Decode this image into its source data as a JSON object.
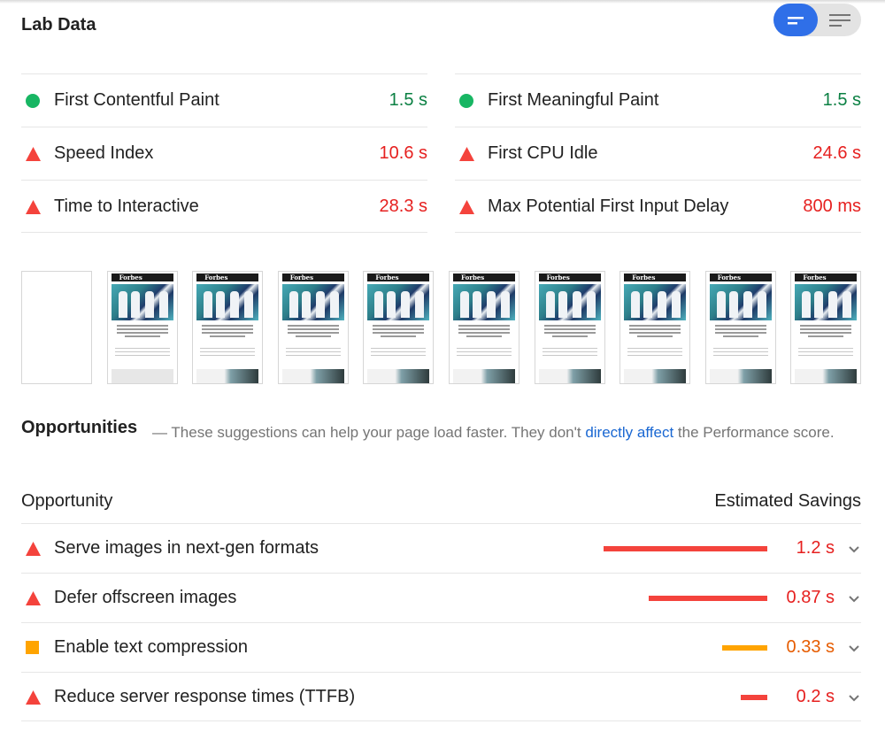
{
  "section_title": "Lab Data",
  "view_toggle": {
    "options": [
      {
        "icon": "opportunity-view-icon",
        "active": true
      },
      {
        "icon": "list-view-icon",
        "active": false
      }
    ],
    "active_color": "#2f6fe8"
  },
  "metrics": {
    "left": [
      {
        "label": "First Contentful Paint",
        "value": "1.5 s",
        "status": "pass"
      },
      {
        "label": "Speed Index",
        "value": "10.6 s",
        "status": "fail"
      },
      {
        "label": "Time to Interactive",
        "value": "28.3 s",
        "status": "fail"
      }
    ],
    "right": [
      {
        "label": "First Meaningful Paint",
        "value": "1.5 s",
        "status": "pass"
      },
      {
        "label": "First CPU Idle",
        "value": "24.6 s",
        "status": "fail"
      },
      {
        "label": "Max Potential First Input Delay",
        "value": "800 ms",
        "status": "fail"
      }
    ]
  },
  "filmstrip": {
    "frame_count": 10,
    "thumbnail_header_text": "Forbes",
    "frames": [
      "blank",
      "text",
      "photo",
      "photo",
      "photo",
      "photo",
      "photo",
      "photo",
      "photo",
      "photo"
    ]
  },
  "opportunities": {
    "title": "Opportunities",
    "description_before_link": "— These suggestions can help your page load faster. They don't ",
    "description_link": "directly affect",
    "description_after_link": " the Performance score.",
    "column_left": "Opportunity",
    "column_right": "Estimated Savings",
    "items": [
      {
        "label": "Serve images in next-gen formats",
        "value": "1.2 s",
        "status": "fail",
        "bar_fraction": 0.91
      },
      {
        "label": "Defer offscreen images",
        "value": "0.87 s",
        "status": "fail",
        "bar_fraction": 0.66
      },
      {
        "label": "Enable text compression",
        "value": "0.33 s",
        "status": "average",
        "bar_fraction": 0.25
      },
      {
        "label": "Reduce server response times (TTFB)",
        "value": "0.2 s",
        "status": "fail",
        "bar_fraction": 0.15
      }
    ]
  },
  "colors": {
    "pass": "#0b8043",
    "fail": "#e6201f",
    "average": "#e65c00",
    "pass_icon": "#18b663",
    "fail_icon": "#f4433c",
    "average_icon": "#ffa400",
    "link": "#1967d2"
  }
}
